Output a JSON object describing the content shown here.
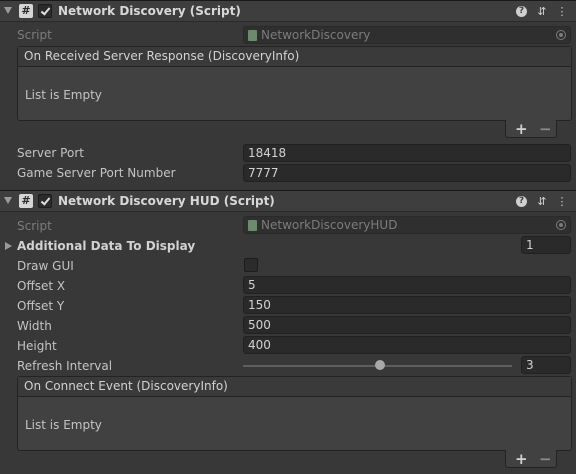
{
  "component1": {
    "title": "Network Discovery (Script)",
    "enabled": true,
    "script_label": "Script",
    "script_value": "NetworkDiscovery",
    "event": {
      "header": "On Received Server Response (DiscoveryInfo)",
      "body": "List is Empty"
    },
    "fields": [
      {
        "label": "Server Port",
        "value": "18418"
      },
      {
        "label": "Game Server Port Number",
        "value": "7777"
      }
    ]
  },
  "component2": {
    "title": "Network Discovery HUD (Script)",
    "enabled": true,
    "script_label": "Script",
    "script_value": "NetworkDiscoveryHUD",
    "additional_data": {
      "label": "Additional Data To Display",
      "count": "1"
    },
    "draw_gui": {
      "label": "Draw GUI",
      "checked": false
    },
    "fields": [
      {
        "label": "Offset X",
        "value": "5"
      },
      {
        "label": "Offset Y",
        "value": "150"
      },
      {
        "label": "Width",
        "value": "500"
      },
      {
        "label": "Height",
        "value": "400"
      }
    ],
    "refresh_interval": {
      "label": "Refresh Interval",
      "value": "3",
      "slider_fraction": 0.5
    },
    "event": {
      "header": "On Connect Event (DiscoveryInfo)",
      "body": "List is Empty"
    }
  },
  "icons": {
    "script": "#",
    "help": "?",
    "settings": "⇵",
    "more": "⋮",
    "add": "+",
    "remove": "−"
  }
}
